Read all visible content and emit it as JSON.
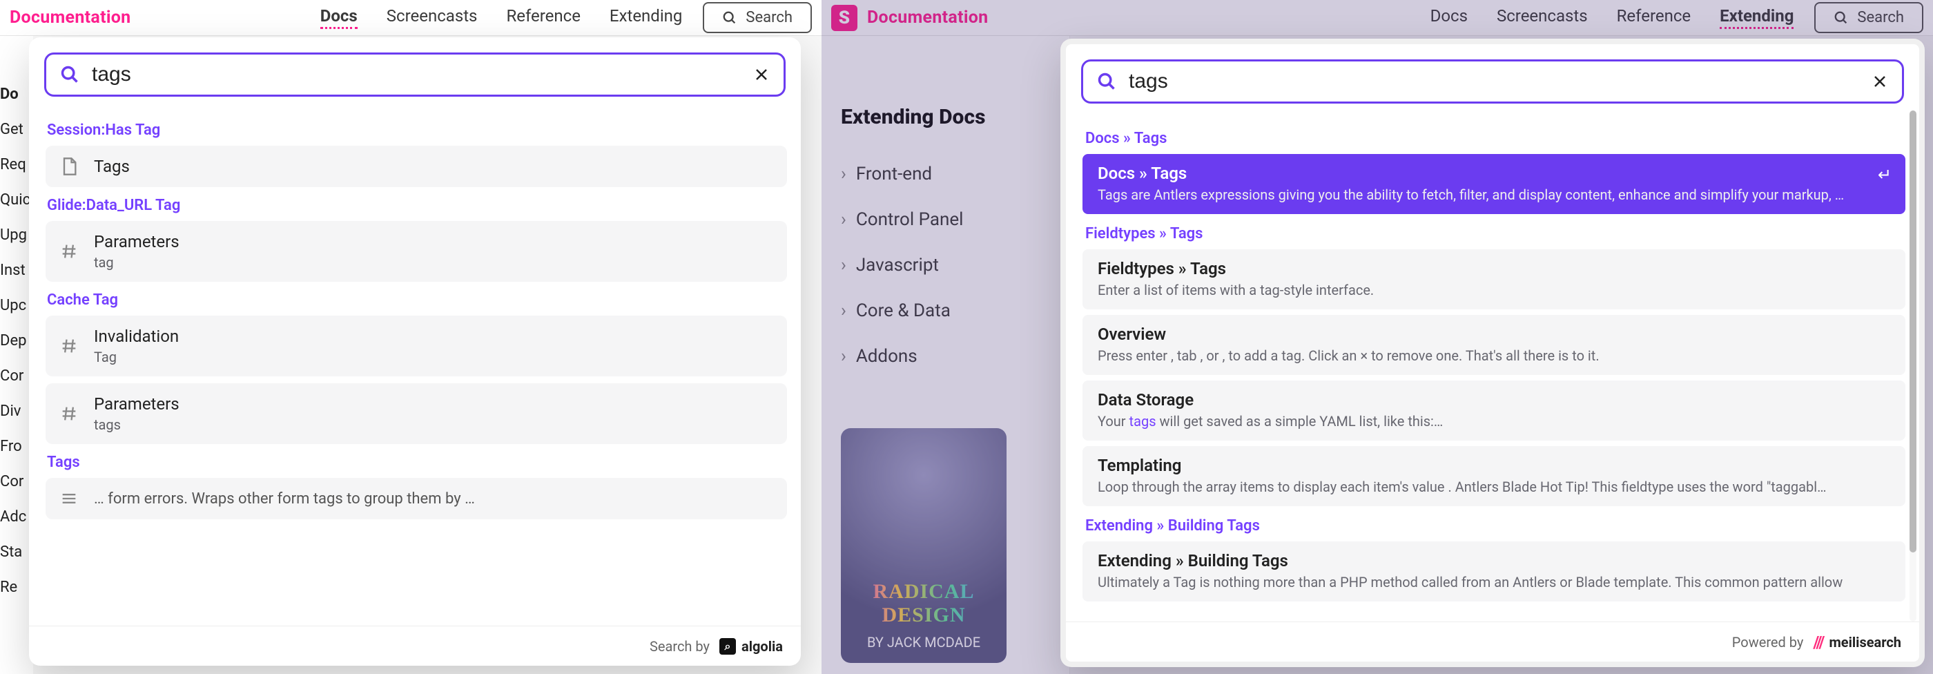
{
  "brand": {
    "letter": "S",
    "name": "Documentation"
  },
  "nav": {
    "docs": "Docs",
    "screencasts": "Screencasts",
    "reference": "Reference",
    "extending": "Extending"
  },
  "search_trigger": "Search",
  "left_sidebar": {
    "heading": "Do",
    "items": [
      "Get",
      "Req",
      "Quic",
      "Upg",
      "Inst",
      "Upc",
      "Dep",
      "Cor",
      "Div",
      "Fro",
      "Cor",
      "Adc",
      "Sta",
      "Re"
    ]
  },
  "right_bg": {
    "heading": "Extending Docs",
    "items": [
      "Front-end",
      "Control Panel",
      "Javascript",
      "Core & Data",
      "Addons"
    ],
    "book": {
      "title": "RADICAL DESIGN",
      "byline": "BY JACK MCDADE"
    }
  },
  "left_modal": {
    "query": "tags",
    "groups": [
      {
        "label": "Session:Has Tag",
        "items": [
          {
            "icon": "doc",
            "title": "Tags"
          }
        ]
      },
      {
        "label": "Glide:Data_URL Tag",
        "items": [
          {
            "icon": "hash",
            "title": "Parameters",
            "sub": "tag"
          }
        ]
      },
      {
        "label": "Cache Tag",
        "items": [
          {
            "icon": "hash",
            "title": "Invalidation",
            "sub": "Tag"
          },
          {
            "icon": "hash",
            "title": "Parameters",
            "sub": "tags"
          }
        ]
      },
      {
        "label": "Tags",
        "items": [
          {
            "icon": "menu",
            "title": "… form errors. Wraps other form tags to group them by …",
            "truncated": true
          }
        ]
      }
    ],
    "footer": {
      "search_by": "Search by",
      "provider": "algolia"
    }
  },
  "right_modal": {
    "query": "tags",
    "groups": [
      {
        "label": "Docs » Tags",
        "items": [
          {
            "highlight": true,
            "title": "Docs » Tags",
            "desc": "Tags are Antlers expressions giving you the ability to fetch, filter, and display content, enhance and simplify your markup, …"
          }
        ]
      },
      {
        "label": "Fieldtypes » Tags",
        "items": [
          {
            "title": "Fieldtypes » Tags",
            "desc": "Enter a list of items with a tag-style interface."
          },
          {
            "title": "Overview",
            "desc": "Press enter , tab , or , to add a tag. Click an × to remove one. That's all there is to it."
          },
          {
            "title": "Data Storage",
            "desc_pre": "Your ",
            "desc_hl": "tags",
            "desc_post": " will get saved as a simple YAML list, like this:…"
          },
          {
            "title": "Templating",
            "desc": "Loop through the array items to display each item's value . Antlers Blade Hot Tip! This fieldtype uses the word \"taggabl…"
          }
        ]
      },
      {
        "label": "Extending » Building Tags",
        "items": [
          {
            "title": "Extending » Building Tags",
            "desc": "Ultimately a Tag is nothing more than a PHP method called from an Antlers or Blade template. This common pattern allow"
          }
        ]
      }
    ],
    "footer": {
      "powered_by": "Powered by",
      "provider": "meilisearch"
    }
  }
}
